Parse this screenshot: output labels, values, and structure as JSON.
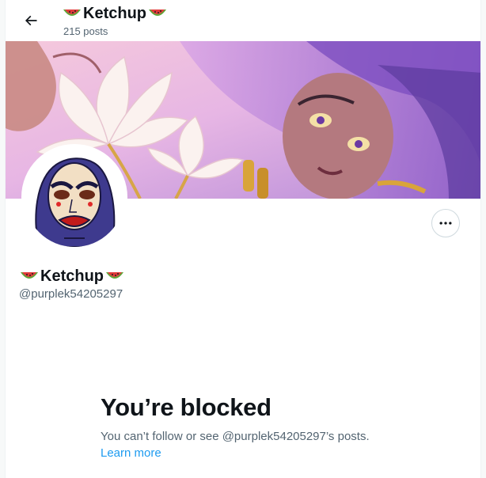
{
  "header": {
    "back_icon": "arrow-left-icon",
    "name": "Ketchup",
    "name_emoji": "watermelon-icon",
    "posts_count": "215 posts"
  },
  "profile": {
    "display_name": "Ketchup",
    "handle": "@purplek54205297",
    "more_icon": "more-horizontal-icon"
  },
  "blocked": {
    "title": "You’re blocked",
    "message": "You can’t follow or see @purplek54205297’s posts.",
    "learn_more": "Learn more"
  },
  "colors": {
    "accent": "#1d9bf0",
    "text_primary": "#0f1419",
    "text_secondary": "#536471",
    "border": "#cfd9de",
    "banner_purple": "#b98ee0",
    "banner_pink": "#f2b7d8"
  }
}
